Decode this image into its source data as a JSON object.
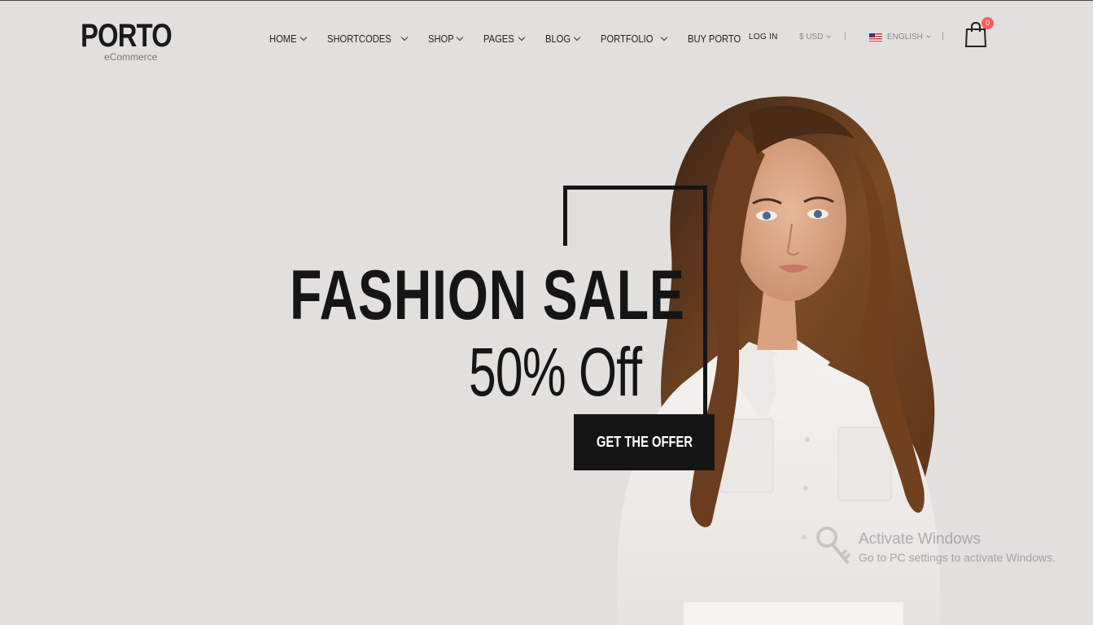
{
  "header": {
    "logo_title": "PORTO",
    "logo_subtitle": "eCommerce",
    "nav": [
      {
        "label": "HOME",
        "has_dropdown": true
      },
      {
        "label": "SHORTCODES",
        "has_dropdown": true
      },
      {
        "label": "SHOP",
        "has_dropdown": true
      },
      {
        "label": "PAGES",
        "has_dropdown": true
      },
      {
        "label": "BLOG",
        "has_dropdown": true
      },
      {
        "label": "PORTFOLIO",
        "has_dropdown": true
      },
      {
        "label": "BUY PORTO",
        "has_dropdown": false
      }
    ],
    "login_label": "LOG IN",
    "currency_label": "$ USD",
    "separator": "|",
    "language_label": "ENGLISH",
    "cart_count": "0",
    "icons": {
      "cart": "shopping-bag-icon",
      "flag": "us-flag-icon",
      "dropdown": "chevron-down-icon"
    }
  },
  "hero": {
    "title": "FASHION SALE",
    "subtitle": "50% Off",
    "cta_label": "GET THE OFFER"
  },
  "watermark": {
    "title": "Activate Windows",
    "subtitle": "Go to PC settings to activate Windows."
  },
  "colors": {
    "background": "#e1e0de",
    "text_dark": "#151515",
    "badge": "#ff5b5b"
  }
}
